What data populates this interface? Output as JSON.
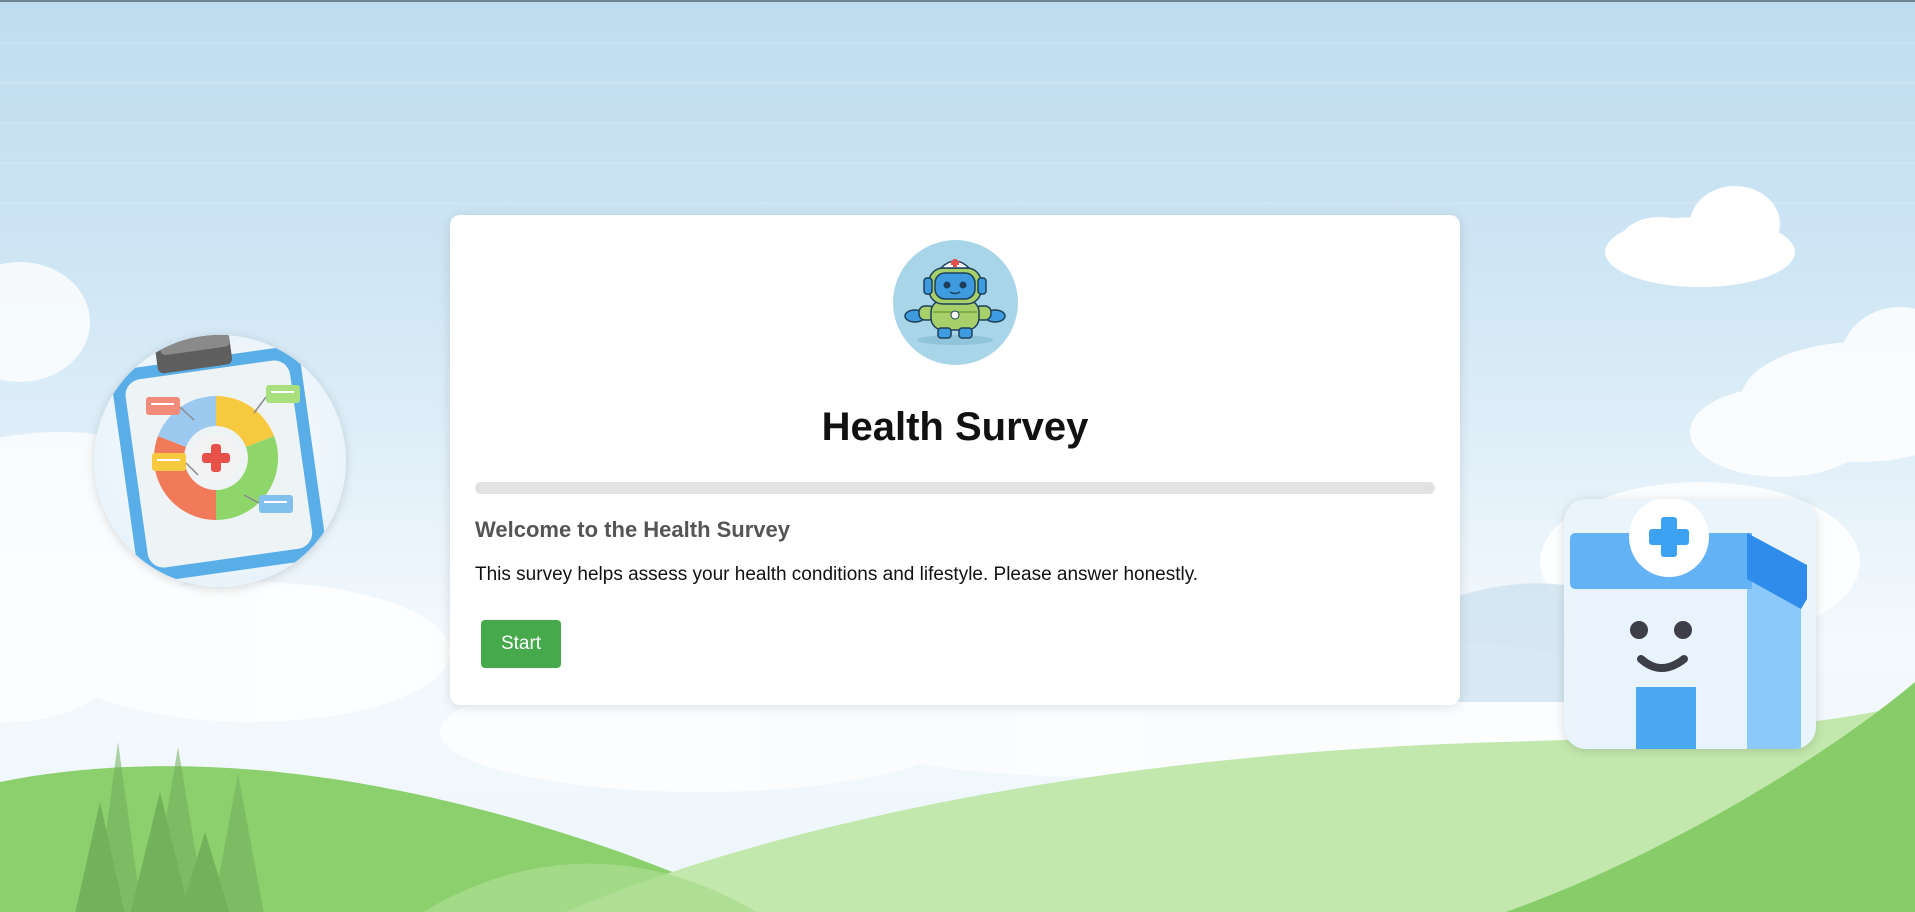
{
  "survey": {
    "title": "Health Survey",
    "progress_fraction": 0,
    "welcome_heading": "Welcome to the Health Survey",
    "description": "This survey helps assess your health conditions and lifestyle. Please answer honestly.",
    "start_label": "Start"
  },
  "icons": {
    "avatar": "robot-doctor-icon",
    "left_illustration": "medical-clipboard-icon",
    "right_illustration": "hospital-building-icon"
  },
  "colors": {
    "accent": "#46a94b",
    "progress_track": "#e2e2e2",
    "avatar_bg": "#a9d5e8"
  }
}
